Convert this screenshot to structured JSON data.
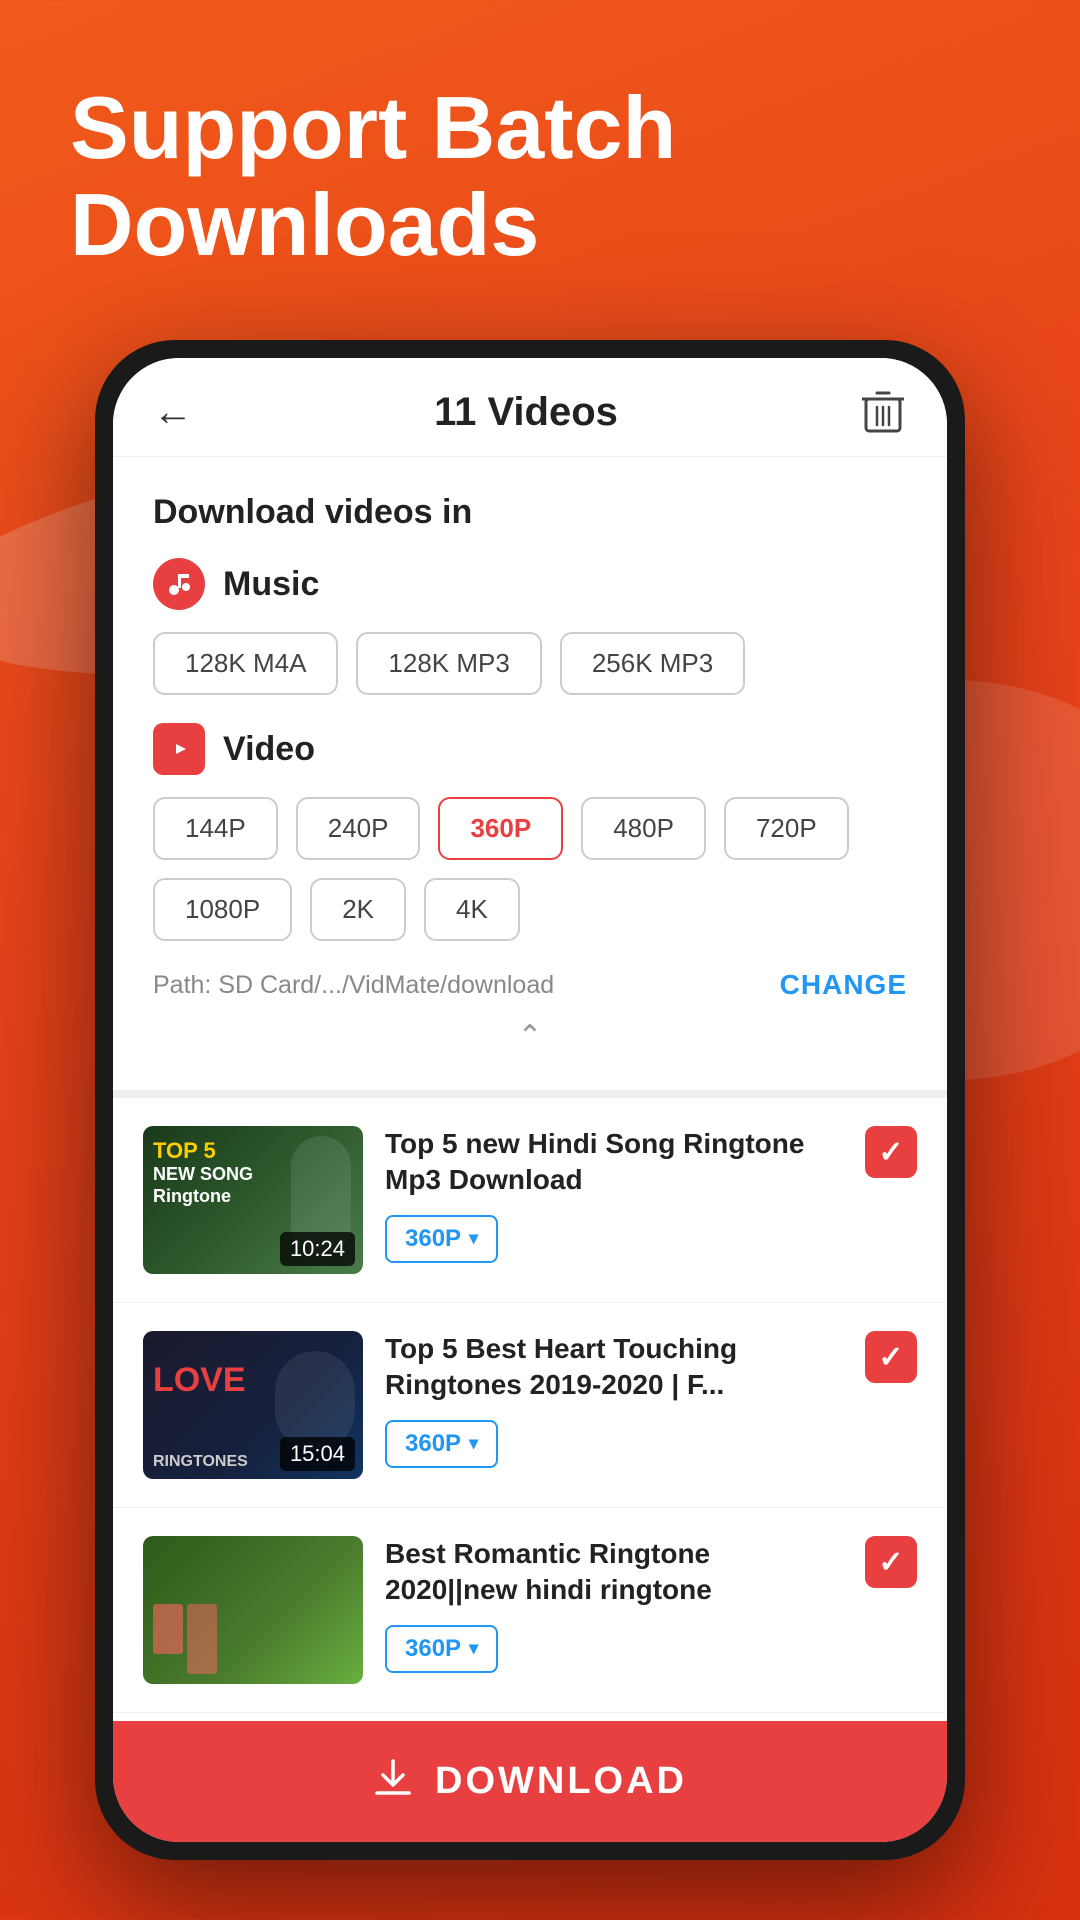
{
  "hero": {
    "title": "Support Batch Downloads"
  },
  "header": {
    "title": "11 Videos",
    "back_label": "←",
    "trash_label": "🗑"
  },
  "format_panel": {
    "section_title": "Download videos in",
    "music_section": {
      "label": "Music",
      "options": [
        "128K  M4A",
        "128K  MP3",
        "256K  MP3"
      ]
    },
    "video_section": {
      "label": "Video",
      "options": [
        "144P",
        "240P",
        "360P",
        "480P",
        "720P",
        "1080P",
        "2K",
        "4K"
      ],
      "selected": "360P"
    },
    "path": {
      "text": "Path: SD Card/.../VidMate/download",
      "change_label": "CHANGE"
    }
  },
  "videos": [
    {
      "title": "Top 5 new Hindi Song Ringtone Mp3 Download",
      "duration": "10:24",
      "quality": "360P",
      "checked": true,
      "thumb_label": "TOP 5\nNEW SONG\nRingtone"
    },
    {
      "title": "Top 5 Best Heart Touching Ringtones 2019-2020 | F...",
      "duration": "15:04",
      "quality": "360P",
      "checked": true,
      "thumb_label": "LOVE\nRINGTONES"
    },
    {
      "title": "Best Romantic Ringtone 2020||new hindi ringtone",
      "duration": "",
      "quality": "360P",
      "checked": true,
      "thumb_label": ""
    }
  ],
  "download_button": {
    "label": "DOWNLOAD"
  }
}
